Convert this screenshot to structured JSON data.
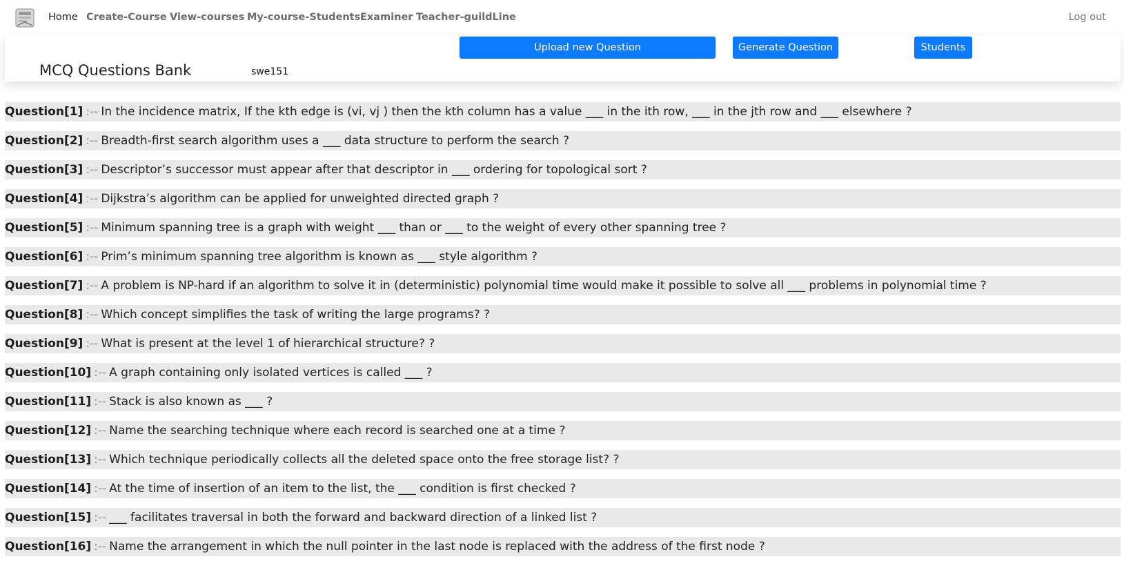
{
  "nav": {
    "items": [
      "Home",
      "Create-Course",
      "View-courses",
      "My-course-Students",
      "Examiner",
      "Teacher-guildLine"
    ],
    "logout": "Log out"
  },
  "header": {
    "title": "MCQ Questions Bank",
    "course_code": "swe151",
    "buttons": {
      "upload": "Upload new Question",
      "generate": "Generate Question",
      "students": "Students"
    }
  },
  "colors": {
    "primary_button": "#0d7bff",
    "row_bg": "#e9e9e9"
  },
  "separator": ":--",
  "questions": [
    {
      "label": "Question[1]",
      "text": "In the incidence matrix, If the kth edge is (vi, vj ) then the kth column has a value ___ in the ith row, ___ in the jth row and ___ elsewhere ?"
    },
    {
      "label": "Question[2]",
      "text": "Breadth-first search algorithm uses a ___ data structure to perform the search ?"
    },
    {
      "label": "Question[3]",
      "text": "Descriptor’s successor must appear after that descriptor in ___ ordering for topological sort ?"
    },
    {
      "label": "Question[4]",
      "text": "Dijkstra’s algorithm can be applied for unweighted directed graph ?"
    },
    {
      "label": "Question[5]",
      "text": "Minimum spanning tree is a graph with weight ___ than or ___ to the weight of every other spanning tree ?"
    },
    {
      "label": "Question[6]",
      "text": "Prim’s minimum spanning tree algorithm is known as ___ style algorithm ?"
    },
    {
      "label": "Question[7]",
      "text": "A problem is NP-hard if an algorithm to solve it in (deterministic) polynomial time would make it possible to solve all ___ problems in polynomial time ?"
    },
    {
      "label": "Question[8]",
      "text": "Which concept simplifies the task of writing the large programs? ?"
    },
    {
      "label": "Question[9]",
      "text": "What is present at the level 1 of hierarchical structure? ?"
    },
    {
      "label": "Question[10]",
      "text": "A graph containing only isolated vertices is called ___ ?"
    },
    {
      "label": "Question[11]",
      "text": "Stack is also known as ___ ?"
    },
    {
      "label": "Question[12]",
      "text": "Name the searching technique where each record is searched one at a time ?"
    },
    {
      "label": "Question[13]",
      "text": "Which technique periodically collects all the deleted space onto the free storage list? ?"
    },
    {
      "label": "Question[14]",
      "text": "At the time of insertion of an item to the list, the ___ condition is first checked ?"
    },
    {
      "label": "Question[15]",
      "text": "___ facilitates traversal in both the forward and backward direction of a linked list ?"
    },
    {
      "label": "Question[16]",
      "text": "Name the arrangement in which the null pointer in the last node is replaced with the address of the first node ?"
    }
  ]
}
